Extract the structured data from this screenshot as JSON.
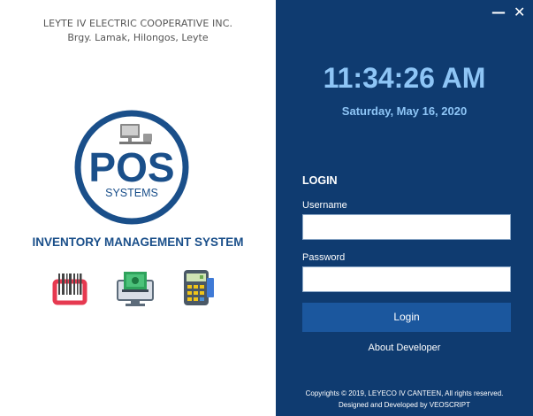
{
  "org": {
    "name": "LEYTE IV ELECTRIC COOPERATIVE INC.",
    "address": "Brgy. Lamak, Hilongos, Leyte"
  },
  "logo": {
    "main_text": "POS",
    "sub_text": "SYSTEMS"
  },
  "app_title": "INVENTORY MANAGEMENT SYSTEM",
  "icons": [
    "barcode-icon",
    "cash-register-icon",
    "payment-terminal-icon"
  ],
  "window_controls": {
    "minimize": "—",
    "close": "✕"
  },
  "clock": {
    "time": "11:34:26 AM",
    "date": "Saturday, May 16, 2020"
  },
  "login": {
    "heading": "LOGIN",
    "username_label": "Username",
    "username_value": "",
    "password_label": "Password",
    "password_value": "",
    "button_label": "Login",
    "about_link": "About Developer"
  },
  "footer": {
    "copyright": "Copyrights © 2019, LEYECO IV CANTEEN, All rights reserved.",
    "credits": "Designed and Developed by VEOSCRIPT"
  },
  "colors": {
    "panel_bg": "#0f3b70",
    "accent": "#1b579e",
    "clock_text": "#8ec5f6",
    "brand_blue": "#1a4f8a"
  }
}
